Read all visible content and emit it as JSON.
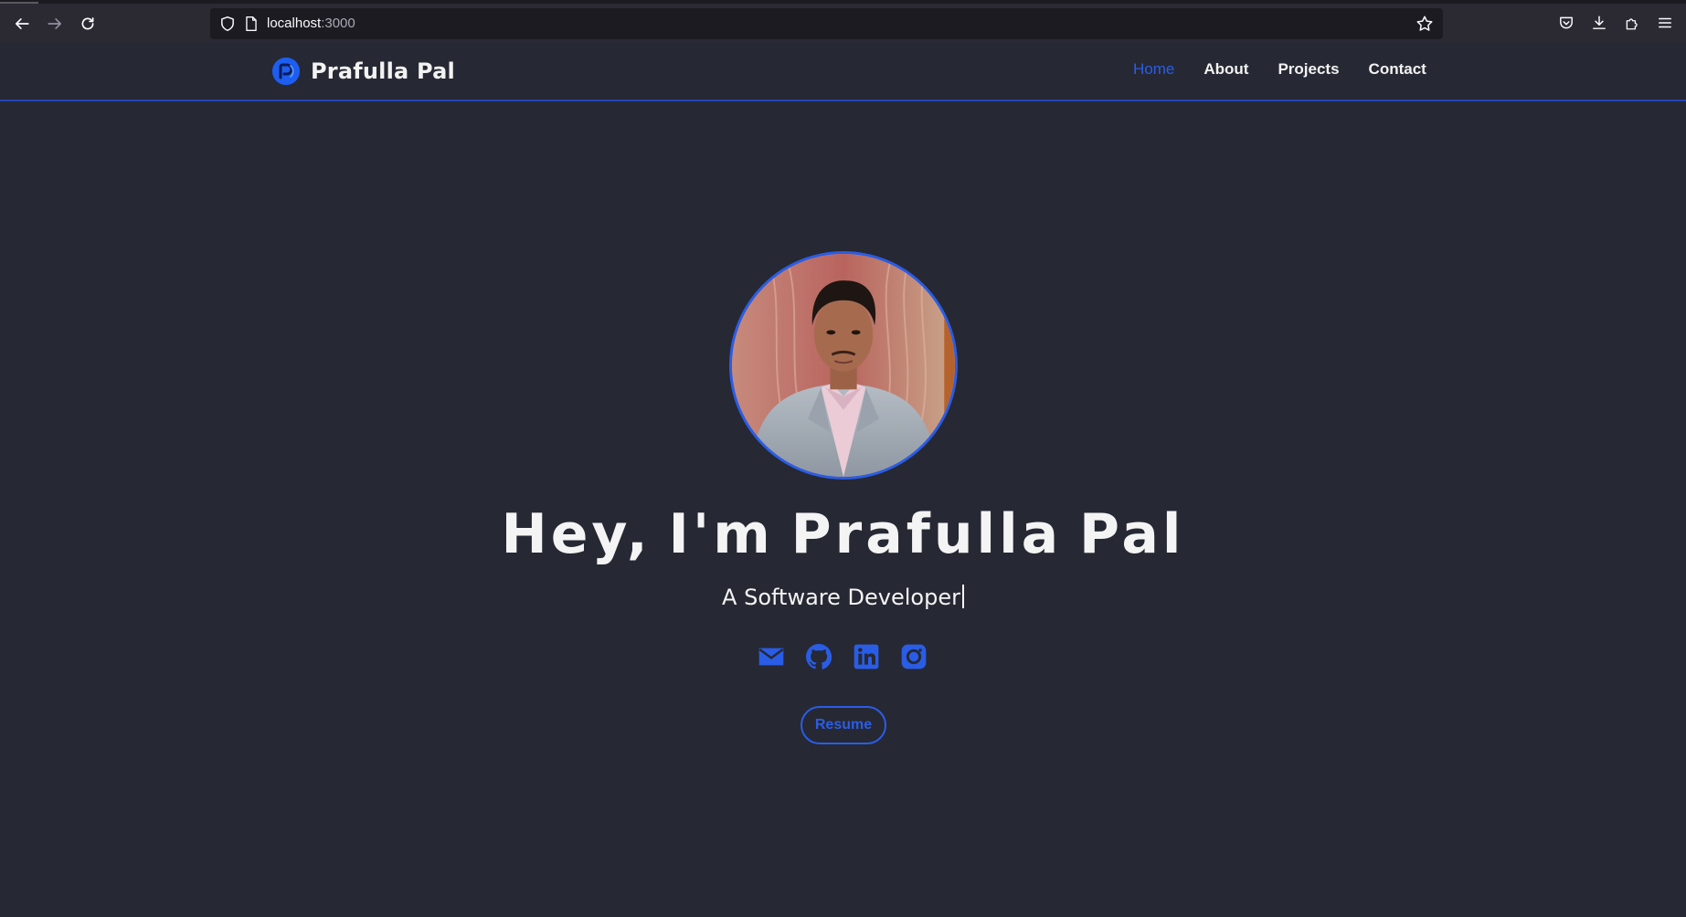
{
  "browser": {
    "url_host": "localhost",
    "url_port": ":3000"
  },
  "navbar": {
    "brand": "Prafulla Pal",
    "links": [
      {
        "label": "Home",
        "active": true
      },
      {
        "label": "About",
        "active": false
      },
      {
        "label": "Projects",
        "active": false
      },
      {
        "label": "Contact",
        "active": false
      }
    ]
  },
  "hero": {
    "headline": "Hey, I'm Prafulla Pal",
    "subtitle": "A Software Developer",
    "socials": [
      {
        "icon": "mail-icon"
      },
      {
        "icon": "github-icon"
      },
      {
        "icon": "linkedin-icon"
      },
      {
        "icon": "instagram-icon"
      }
    ],
    "resume_label": "Resume"
  },
  "colors": {
    "background": "#262833",
    "accent": "#2a5de6",
    "text": "#f4f4f4"
  }
}
